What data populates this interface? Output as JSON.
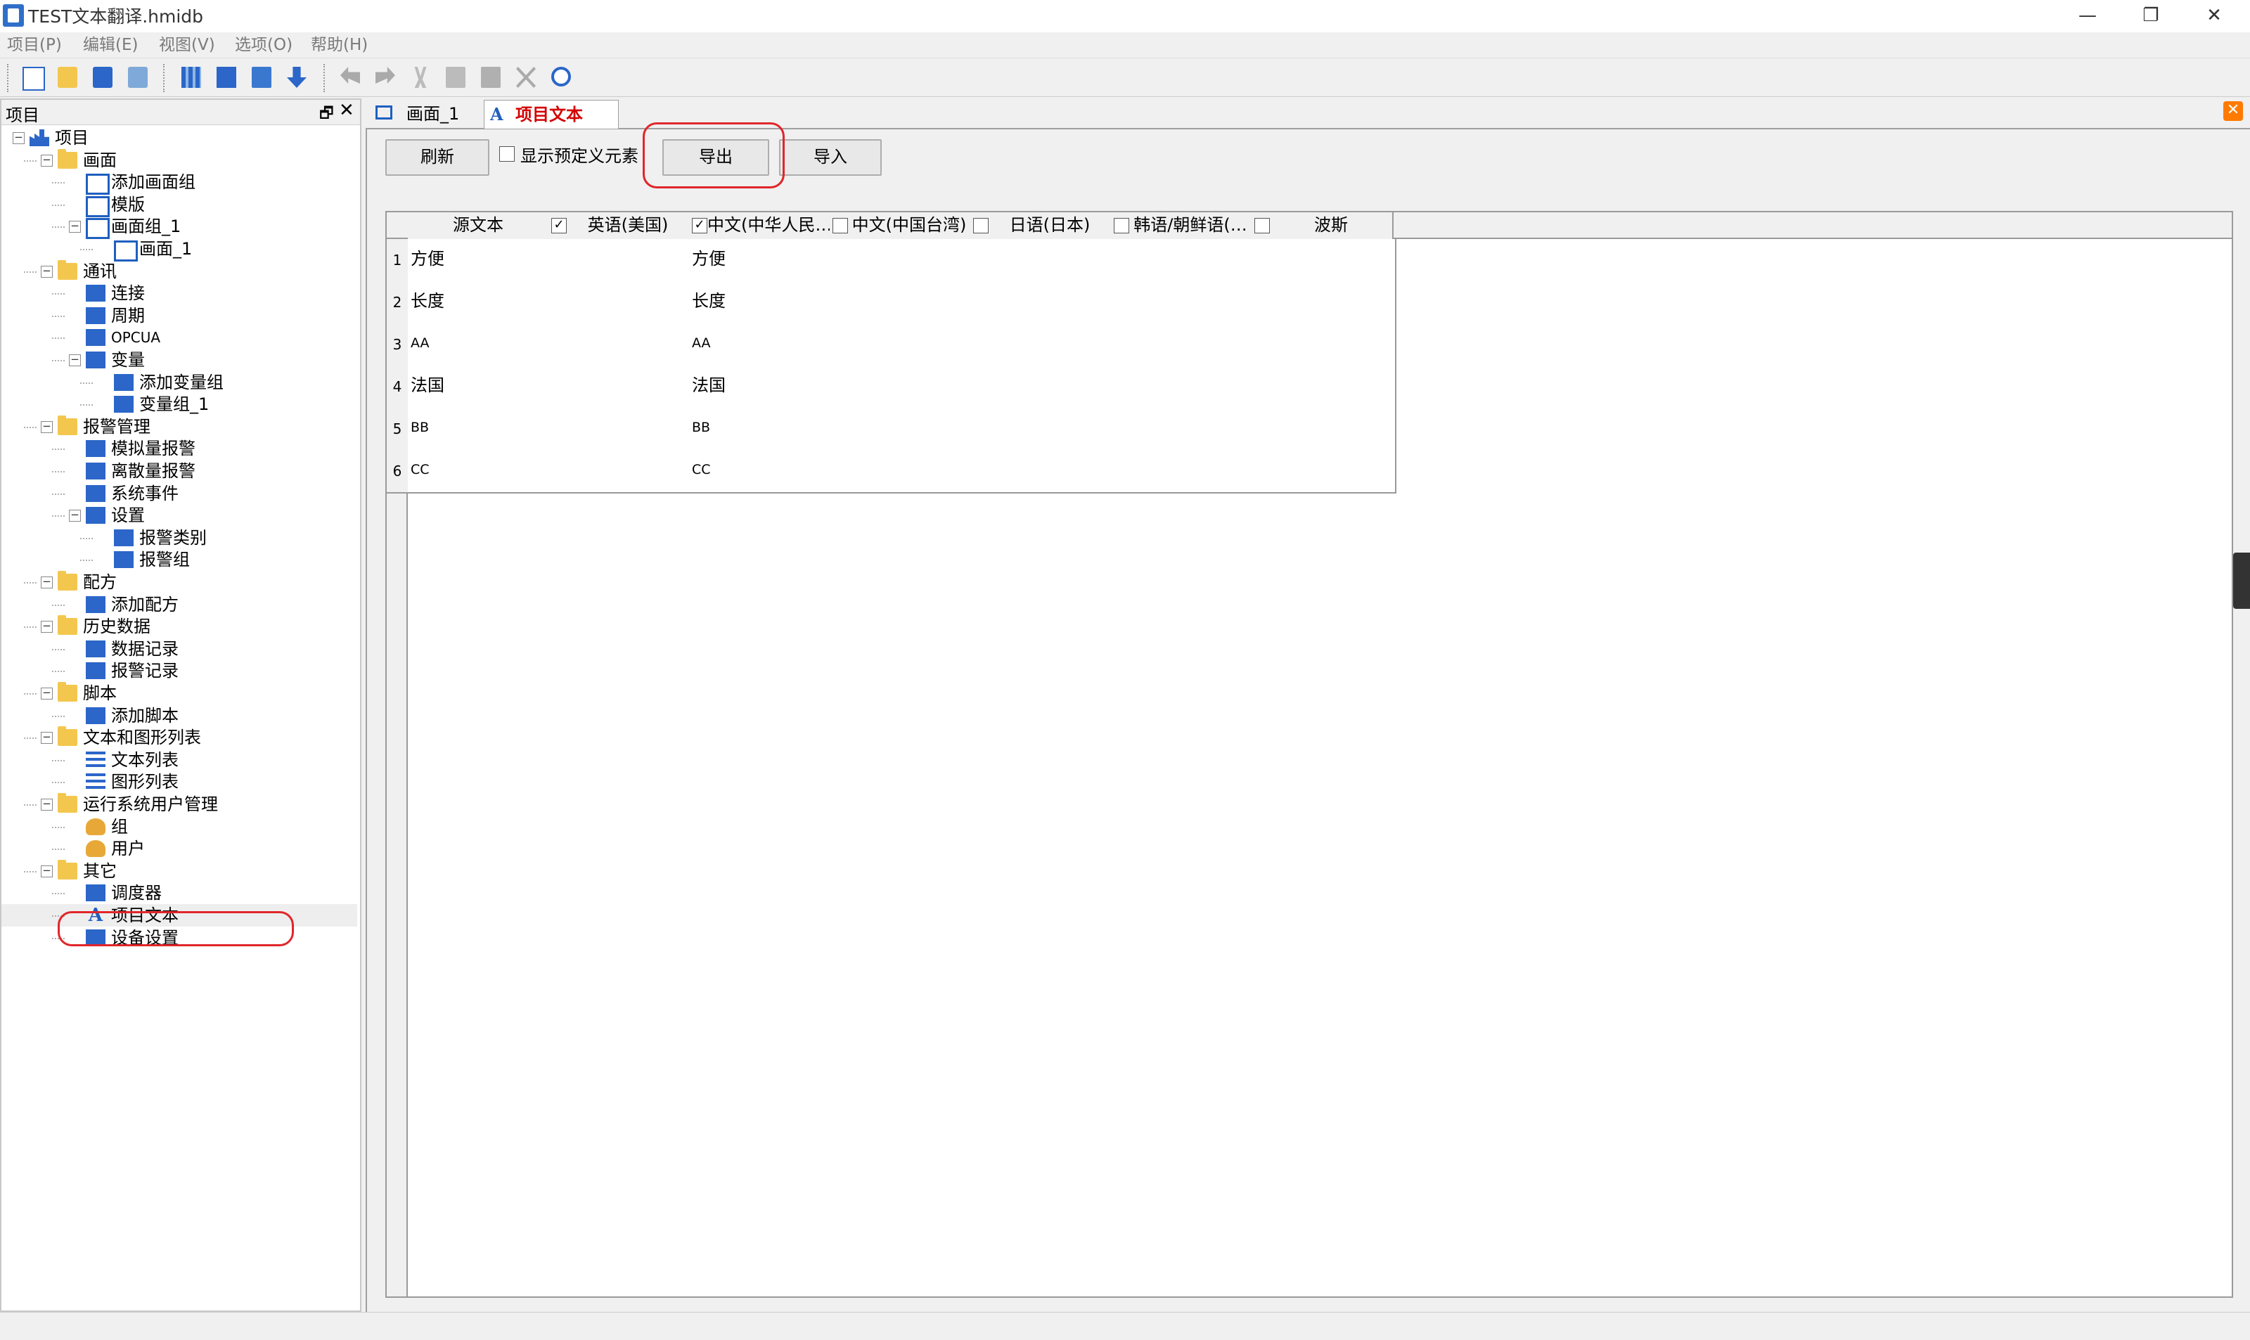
{
  "window": {
    "title": "TEST文本翻译.hmidb",
    "minimize": "—",
    "maximize": "❐",
    "close": "✕"
  },
  "menu": [
    "项目(P)",
    "编辑(E)",
    "视图(V)",
    "选项(O)",
    "帮助(H)"
  ],
  "toolbar_icons": [
    "new-file-icon",
    "open-folder-icon",
    "save-icon",
    "print-icon",
    "compile-icon",
    "download-icon",
    "simulate-icon",
    "transfer-icon",
    "undo-icon",
    "redo-icon",
    "cut-icon",
    "copy-icon",
    "paste-icon",
    "delete-icon",
    "find-icon"
  ],
  "tree": {
    "title": "项目",
    "pin": "🗗",
    "close": "✕",
    "items": [
      {
        "label": "项目",
        "icon": "factory-icon",
        "level": 0,
        "toggle": "−"
      },
      {
        "label": "画面",
        "icon": "folder-icon",
        "level": 1,
        "toggle": "−"
      },
      {
        "label": "添加画面组",
        "icon": "add-screen-group-icon",
        "level": 2
      },
      {
        "label": "模版",
        "icon": "template-icon",
        "level": 2
      },
      {
        "label": "画面组_1",
        "icon": "screen-group-icon",
        "level": 2,
        "toggle": "−"
      },
      {
        "label": "画面_1",
        "icon": "screen-icon",
        "level": 3
      },
      {
        "label": "通讯",
        "icon": "folder-icon",
        "level": 1,
        "toggle": "−"
      },
      {
        "label": "连接",
        "icon": "connection-icon",
        "level": 2
      },
      {
        "label": "周期",
        "icon": "cycle-icon",
        "level": 2
      },
      {
        "label": "OPCUA",
        "icon": "opcua-icon",
        "level": 2
      },
      {
        "label": "变量",
        "icon": "variable-icon",
        "level": 2,
        "toggle": "−"
      },
      {
        "label": "添加变量组",
        "icon": "add-variable-group-icon",
        "level": 3
      },
      {
        "label": "变量组_1",
        "icon": "variable-group-icon",
        "level": 3
      },
      {
        "label": "报警管理",
        "icon": "alarm-folder-icon",
        "level": 1,
        "toggle": "−"
      },
      {
        "label": "模拟量报警",
        "icon": "analog-alarm-icon",
        "level": 2
      },
      {
        "label": "离散量报警",
        "icon": "discrete-alarm-icon",
        "level": 2
      },
      {
        "label": "系统事件",
        "icon": "system-event-icon",
        "level": 2
      },
      {
        "label": "设置",
        "icon": "settings-icon",
        "level": 2,
        "toggle": "−"
      },
      {
        "label": "报警类别",
        "icon": "alarm-class-icon",
        "level": 3
      },
      {
        "label": "报警组",
        "icon": "alarm-group-icon",
        "level": 3
      },
      {
        "label": "配方",
        "icon": "folder-icon",
        "level": 1,
        "toggle": "−"
      },
      {
        "label": "添加配方",
        "icon": "add-recipe-icon",
        "level": 2
      },
      {
        "label": "历史数据",
        "icon": "folder-icon",
        "level": 1,
        "toggle": "−"
      },
      {
        "label": "数据记录",
        "icon": "data-log-icon",
        "level": 2
      },
      {
        "label": "报警记录",
        "icon": "alarm-log-icon",
        "level": 2
      },
      {
        "label": "脚本",
        "icon": "folder-icon",
        "level": 1,
        "toggle": "−"
      },
      {
        "label": "添加脚本",
        "icon": "add-script-icon",
        "level": 2
      },
      {
        "label": "文本和图形列表",
        "icon": "folder-icon",
        "level": 1,
        "toggle": "−"
      },
      {
        "label": "文本列表",
        "icon": "text-list-icon",
        "level": 2
      },
      {
        "label": "图形列表",
        "icon": "graphic-list-icon",
        "level": 2
      },
      {
        "label": "运行系统用户管理",
        "icon": "user-admin-folder-icon",
        "level": 1,
        "toggle": "−"
      },
      {
        "label": "组",
        "icon": "group-icon",
        "level": 2
      },
      {
        "label": "用户",
        "icon": "user-icon",
        "level": 2
      },
      {
        "label": "其它",
        "icon": "folder-icon",
        "level": 1,
        "toggle": "−"
      },
      {
        "label": "调度器",
        "icon": "scheduler-icon",
        "level": 2
      },
      {
        "label": "项目文本",
        "icon": "project-text-icon",
        "level": 2,
        "selected": true
      },
      {
        "label": "设备设置",
        "icon": "device-settings-icon",
        "level": 2
      }
    ]
  },
  "tabs": [
    {
      "label": "画面_1",
      "icon": "screen-icon"
    },
    {
      "label": "项目文本",
      "icon": "project-text-icon",
      "active": true
    }
  ],
  "tab_close": "✕",
  "actions": {
    "refresh": "刷新",
    "show_predefined": "显示预定义元素",
    "show_predefined_checked": false,
    "export": "导出",
    "import": "导入"
  },
  "grid": {
    "columns": [
      {
        "label": "源文本",
        "checkbox": false
      },
      {
        "label": "英语(美国)",
        "checkbox": true,
        "checked": true
      },
      {
        "label": "中文(中华人民…",
        "checkbox": true,
        "checked": true
      },
      {
        "label": "中文(中国台湾)",
        "checkbox": true,
        "checked": false
      },
      {
        "label": "日语(日本)",
        "checkbox": true,
        "checked": false
      },
      {
        "label": "韩语/朝鲜语(…",
        "checkbox": true,
        "checked": false
      },
      {
        "label": "波斯",
        "checkbox": true,
        "checked": false
      }
    ],
    "rows": [
      {
        "n": "1",
        "cells": [
          "方便",
          "",
          "方便",
          "",
          "",
          "",
          ""
        ]
      },
      {
        "n": "2",
        "cells": [
          "长度",
          "",
          "长度",
          "",
          "",
          "",
          ""
        ]
      },
      {
        "n": "3",
        "cells": [
          "AA",
          "",
          "AA",
          "",
          "",
          "",
          ""
        ]
      },
      {
        "n": "4",
        "cells": [
          "法国",
          "",
          "法国",
          "",
          "",
          "",
          ""
        ]
      },
      {
        "n": "5",
        "cells": [
          "BB",
          "",
          "BB",
          "",
          "",
          "",
          ""
        ]
      },
      {
        "n": "6",
        "cells": [
          "CC",
          "",
          "CC",
          "",
          "",
          "",
          ""
        ]
      }
    ]
  },
  "colors": {
    "annotation": "#e0262b",
    "active_tab_text": "#d40000",
    "selection": "#eeeeee"
  }
}
